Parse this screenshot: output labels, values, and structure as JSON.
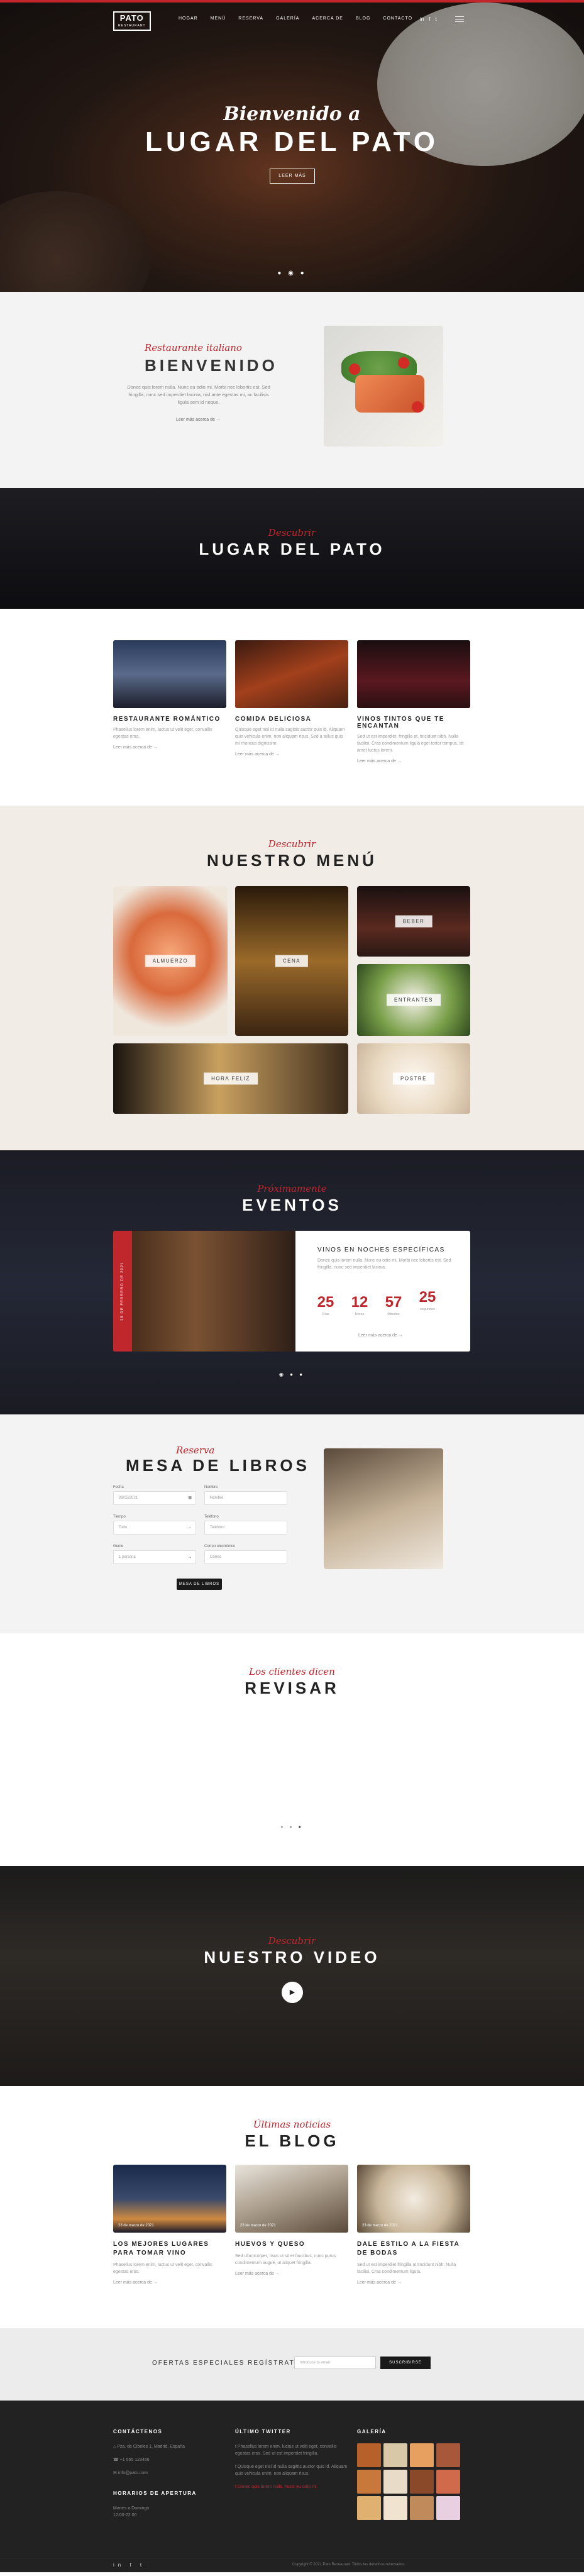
{
  "nav": {
    "logo_main": "PATO",
    "logo_sub": "RESTAURANT",
    "items": [
      "HOGAR",
      "MENÚ",
      "RESERVA",
      "GALERÍA",
      "ACERCA DE",
      "BLOG",
      "CONTACTO"
    ],
    "social": [
      "in",
      "f",
      "t"
    ]
  },
  "hero": {
    "welcome": "Bienvenido a",
    "title": "LUGAR DEL PATO",
    "button": "LEER MÁS"
  },
  "welcome": {
    "subtitle": "Restaurante italiano",
    "title": "BIENVENIDO",
    "text": "Donec quis lorem nulla. Nunc eu odio mi. Morbi nec lobortis est. Sed fringilla, nunc sed imperdiet lacinia, nisl ante egestas mi, ac facilisis ligula sem id neque.",
    "more": "Leer más acerca de"
  },
  "banner": {
    "subtitle": "Descubrir",
    "title": "LUGAR DEL PATO"
  },
  "features": [
    {
      "title": "RESTAURANTE ROMÁNTICO",
      "text": "Phasellus lorem enim, luctus ut velit eget, convallis egestas eros.",
      "more": "Leer más acerca de"
    },
    {
      "title": "COMIDA DELICIOSA",
      "text": "Quisque eget nisl id nulla sagittis auctor quis id. Aliquam quis vehicula enim, non aliquam risus. Sed a tellus quis mi rhoncus dignissim.",
      "more": "Leer más acerca de"
    },
    {
      "title": "VINOS TINTOS QUE TE ENCANTAN",
      "text": "Sed ut est imperdiet, fringilla at, tincidunt nibh. Nulla facilisi. Cras condimentum ligula eget tortor tempus, sit amet luctus lorem.",
      "more": "Leer más acerca de"
    }
  ],
  "menu": {
    "subtitle": "Descubrir",
    "title": "NUESTRO MENÚ",
    "tiles": [
      "ALMUERZO",
      "CENA",
      "BEBER",
      "ENTRANTES",
      "HORA FELIZ",
      "POSTRE"
    ]
  },
  "events": {
    "subtitle": "Próximamente",
    "title": "EVENTOS",
    "tag": "28 DE FEBRERO DE 2021",
    "card_title": "VINOS EN NOCHES ESPECÍFICAS",
    "card_text": "Donec quis lorem nulla. Nunc eu odio mi. Morbi nec lobortis est. Sed fringilla, nunc sed imperdiet lacinia.",
    "countdown": [
      {
        "value": "25",
        "label": "Días"
      },
      {
        "value": "12",
        "label": "Horas"
      },
      {
        "value": "57",
        "label": "Minutos"
      },
      {
        "value": "25",
        "label": "segundos"
      }
    ],
    "more": "Leer más acerca de"
  },
  "reservation": {
    "subtitle": "Reserva",
    "title": "MESA DE LIBROS",
    "fields": [
      {
        "label": "Fecha",
        "value": "28/02/2021"
      },
      {
        "label": "Nombre",
        "value": "Nombre"
      },
      {
        "label": "Tiempo",
        "value": "Todo"
      },
      {
        "label": "Teléfono",
        "value": "Teléfono"
      },
      {
        "label": "Gente",
        "value": "1 persona"
      },
      {
        "label": "Correo electrónico",
        "value": "Correo"
      }
    ],
    "button": "MESA DE LIBROS"
  },
  "reviews": {
    "subtitle": "Los clientes dicen",
    "title": "REVISAR"
  },
  "video": {
    "subtitle": "Descubrir",
    "title": "NUESTRO VIDEO"
  },
  "blog": {
    "subtitle": "Últimas noticias",
    "title": "EL BLOG",
    "posts": [
      {
        "date": "23 de marzo de 2021",
        "title": "LOS MEJORES LUGARES PARA TOMAR VINO",
        "text": "Phasellus lorem enim, luctus ut velit eget, convallis egestas eros.",
        "more": "Leer más acerca de"
      },
      {
        "date": "23 de marzo de 2021",
        "title": "HUEVOS Y QUESO",
        "text": "Sed ullamcorper, risus ut sit et faucibus, nunc purus condimentum augue, ut aliquet fringilla.",
        "more": "Leer más acerca de"
      },
      {
        "date": "23 de marzo de 2021",
        "title": "DALE ESTILO A LA FIESTA DE BODAS",
        "text": "Sed ut est imperdiet fringilla at tincidunt nibh. Nulla facilisi. Cras condimentum ligula.",
        "more": "Leer más acerca de"
      }
    ]
  },
  "newsletter": {
    "label": "OFERTAS ESPECIALES REGÍSTRATE",
    "placeholder": "Introduce tu email",
    "button": "SUSCRIBIRSE"
  },
  "footer": {
    "contact_title": "CONTÁCTENOS",
    "address": "Pza. de Cibeles 1, Madrid, España",
    "phone": "+1 555 123456",
    "email": "info@pato.com",
    "hours_title": "HORARIOS DE APERTURA",
    "hours": "Martes a Domingo",
    "hours2": "12:00-22:00",
    "twitter_title": "ÚLTIMO TWITTER",
    "tweets": [
      "Phasellus lorem enim, luctus ut velit eget, convallis egestas eros. Sed ut est imperdiet fringilla.",
      "Quisque eget nisl id nulla sagittis auctor quis id. Aliquam quis vehicula enim, non aliquam risus.",
      "Donec quis lorem nulla. Nunc eu odio mi."
    ],
    "gallery_title": "GALERÍA",
    "social": "in f t",
    "copyright": "Copyright © 2021 Pato Restaurant. Todos los derechos reservados."
  }
}
